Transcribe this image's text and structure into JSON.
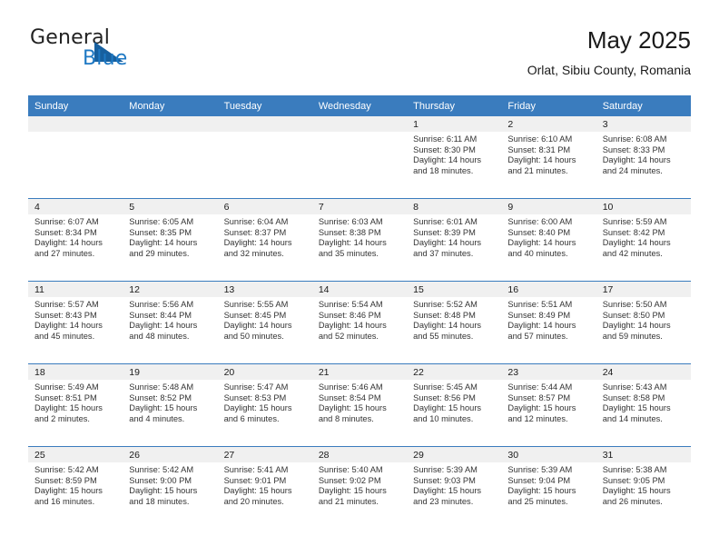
{
  "brand": {
    "name_part1": "General",
    "name_part2": "Blue",
    "logo_icon": "triangle-icon"
  },
  "header": {
    "title": "May 2025",
    "subtitle": "Orlat, Sibiu County, Romania"
  },
  "colors": {
    "header_blue": "#3a7cbe",
    "brand_blue": "#1f79c4",
    "daynum_strip": "#f0f0f0"
  },
  "weekday_headers": [
    "Sunday",
    "Monday",
    "Tuesday",
    "Wednesday",
    "Thursday",
    "Friday",
    "Saturday"
  ],
  "weeks": [
    [
      {
        "day": "",
        "sunrise": "",
        "sunset": "",
        "daylight_line1": "",
        "daylight_line2": ""
      },
      {
        "day": "",
        "sunrise": "",
        "sunset": "",
        "daylight_line1": "",
        "daylight_line2": ""
      },
      {
        "day": "",
        "sunrise": "",
        "sunset": "",
        "daylight_line1": "",
        "daylight_line2": ""
      },
      {
        "day": "",
        "sunrise": "",
        "sunset": "",
        "daylight_line1": "",
        "daylight_line2": ""
      },
      {
        "day": "1",
        "sunrise": "Sunrise: 6:11 AM",
        "sunset": "Sunset: 8:30 PM",
        "daylight_line1": "Daylight: 14 hours",
        "daylight_line2": "and 18 minutes."
      },
      {
        "day": "2",
        "sunrise": "Sunrise: 6:10 AM",
        "sunset": "Sunset: 8:31 PM",
        "daylight_line1": "Daylight: 14 hours",
        "daylight_line2": "and 21 minutes."
      },
      {
        "day": "3",
        "sunrise": "Sunrise: 6:08 AM",
        "sunset": "Sunset: 8:33 PM",
        "daylight_line1": "Daylight: 14 hours",
        "daylight_line2": "and 24 minutes."
      }
    ],
    [
      {
        "day": "4",
        "sunrise": "Sunrise: 6:07 AM",
        "sunset": "Sunset: 8:34 PM",
        "daylight_line1": "Daylight: 14 hours",
        "daylight_line2": "and 27 minutes."
      },
      {
        "day": "5",
        "sunrise": "Sunrise: 6:05 AM",
        "sunset": "Sunset: 8:35 PM",
        "daylight_line1": "Daylight: 14 hours",
        "daylight_line2": "and 29 minutes."
      },
      {
        "day": "6",
        "sunrise": "Sunrise: 6:04 AM",
        "sunset": "Sunset: 8:37 PM",
        "daylight_line1": "Daylight: 14 hours",
        "daylight_line2": "and 32 minutes."
      },
      {
        "day": "7",
        "sunrise": "Sunrise: 6:03 AM",
        "sunset": "Sunset: 8:38 PM",
        "daylight_line1": "Daylight: 14 hours",
        "daylight_line2": "and 35 minutes."
      },
      {
        "day": "8",
        "sunrise": "Sunrise: 6:01 AM",
        "sunset": "Sunset: 8:39 PM",
        "daylight_line1": "Daylight: 14 hours",
        "daylight_line2": "and 37 minutes."
      },
      {
        "day": "9",
        "sunrise": "Sunrise: 6:00 AM",
        "sunset": "Sunset: 8:40 PM",
        "daylight_line1": "Daylight: 14 hours",
        "daylight_line2": "and 40 minutes."
      },
      {
        "day": "10",
        "sunrise": "Sunrise: 5:59 AM",
        "sunset": "Sunset: 8:42 PM",
        "daylight_line1": "Daylight: 14 hours",
        "daylight_line2": "and 42 minutes."
      }
    ],
    [
      {
        "day": "11",
        "sunrise": "Sunrise: 5:57 AM",
        "sunset": "Sunset: 8:43 PM",
        "daylight_line1": "Daylight: 14 hours",
        "daylight_line2": "and 45 minutes."
      },
      {
        "day": "12",
        "sunrise": "Sunrise: 5:56 AM",
        "sunset": "Sunset: 8:44 PM",
        "daylight_line1": "Daylight: 14 hours",
        "daylight_line2": "and 48 minutes."
      },
      {
        "day": "13",
        "sunrise": "Sunrise: 5:55 AM",
        "sunset": "Sunset: 8:45 PM",
        "daylight_line1": "Daylight: 14 hours",
        "daylight_line2": "and 50 minutes."
      },
      {
        "day": "14",
        "sunrise": "Sunrise: 5:54 AM",
        "sunset": "Sunset: 8:46 PM",
        "daylight_line1": "Daylight: 14 hours",
        "daylight_line2": "and 52 minutes."
      },
      {
        "day": "15",
        "sunrise": "Sunrise: 5:52 AM",
        "sunset": "Sunset: 8:48 PM",
        "daylight_line1": "Daylight: 14 hours",
        "daylight_line2": "and 55 minutes."
      },
      {
        "day": "16",
        "sunrise": "Sunrise: 5:51 AM",
        "sunset": "Sunset: 8:49 PM",
        "daylight_line1": "Daylight: 14 hours",
        "daylight_line2": "and 57 minutes."
      },
      {
        "day": "17",
        "sunrise": "Sunrise: 5:50 AM",
        "sunset": "Sunset: 8:50 PM",
        "daylight_line1": "Daylight: 14 hours",
        "daylight_line2": "and 59 minutes."
      }
    ],
    [
      {
        "day": "18",
        "sunrise": "Sunrise: 5:49 AM",
        "sunset": "Sunset: 8:51 PM",
        "daylight_line1": "Daylight: 15 hours",
        "daylight_line2": "and 2 minutes."
      },
      {
        "day": "19",
        "sunrise": "Sunrise: 5:48 AM",
        "sunset": "Sunset: 8:52 PM",
        "daylight_line1": "Daylight: 15 hours",
        "daylight_line2": "and 4 minutes."
      },
      {
        "day": "20",
        "sunrise": "Sunrise: 5:47 AM",
        "sunset": "Sunset: 8:53 PM",
        "daylight_line1": "Daylight: 15 hours",
        "daylight_line2": "and 6 minutes."
      },
      {
        "day": "21",
        "sunrise": "Sunrise: 5:46 AM",
        "sunset": "Sunset: 8:54 PM",
        "daylight_line1": "Daylight: 15 hours",
        "daylight_line2": "and 8 minutes."
      },
      {
        "day": "22",
        "sunrise": "Sunrise: 5:45 AM",
        "sunset": "Sunset: 8:56 PM",
        "daylight_line1": "Daylight: 15 hours",
        "daylight_line2": "and 10 minutes."
      },
      {
        "day": "23",
        "sunrise": "Sunrise: 5:44 AM",
        "sunset": "Sunset: 8:57 PM",
        "daylight_line1": "Daylight: 15 hours",
        "daylight_line2": "and 12 minutes."
      },
      {
        "day": "24",
        "sunrise": "Sunrise: 5:43 AM",
        "sunset": "Sunset: 8:58 PM",
        "daylight_line1": "Daylight: 15 hours",
        "daylight_line2": "and 14 minutes."
      }
    ],
    [
      {
        "day": "25",
        "sunrise": "Sunrise: 5:42 AM",
        "sunset": "Sunset: 8:59 PM",
        "daylight_line1": "Daylight: 15 hours",
        "daylight_line2": "and 16 minutes."
      },
      {
        "day": "26",
        "sunrise": "Sunrise: 5:42 AM",
        "sunset": "Sunset: 9:00 PM",
        "daylight_line1": "Daylight: 15 hours",
        "daylight_line2": "and 18 minutes."
      },
      {
        "day": "27",
        "sunrise": "Sunrise: 5:41 AM",
        "sunset": "Sunset: 9:01 PM",
        "daylight_line1": "Daylight: 15 hours",
        "daylight_line2": "and 20 minutes."
      },
      {
        "day": "28",
        "sunrise": "Sunrise: 5:40 AM",
        "sunset": "Sunset: 9:02 PM",
        "daylight_line1": "Daylight: 15 hours",
        "daylight_line2": "and 21 minutes."
      },
      {
        "day": "29",
        "sunrise": "Sunrise: 5:39 AM",
        "sunset": "Sunset: 9:03 PM",
        "daylight_line1": "Daylight: 15 hours",
        "daylight_line2": "and 23 minutes."
      },
      {
        "day": "30",
        "sunrise": "Sunrise: 5:39 AM",
        "sunset": "Sunset: 9:04 PM",
        "daylight_line1": "Daylight: 15 hours",
        "daylight_line2": "and 25 minutes."
      },
      {
        "day": "31",
        "sunrise": "Sunrise: 5:38 AM",
        "sunset": "Sunset: 9:05 PM",
        "daylight_line1": "Daylight: 15 hours",
        "daylight_line2": "and 26 minutes."
      }
    ]
  ]
}
